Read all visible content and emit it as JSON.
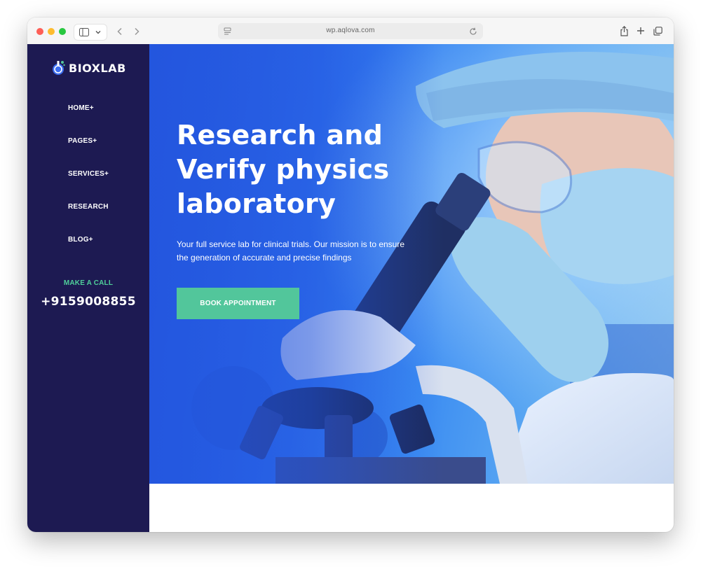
{
  "browser": {
    "url": "wp.aqlova.com"
  },
  "brand": {
    "name": "BIOXLAB",
    "accent": "#52c69b",
    "sidebar_bg": "#1d1a52",
    "hero_blue": "#2f72ee"
  },
  "nav": {
    "items": [
      {
        "label": "HOME+"
      },
      {
        "label": "PAGES+"
      },
      {
        "label": "SERVICES+"
      },
      {
        "label": "RESEARCH"
      },
      {
        "label": "BLOG+"
      }
    ]
  },
  "contact": {
    "label": "MAKE A CALL",
    "phone": "+9159008855"
  },
  "hero": {
    "headline_line1": "Research and",
    "headline_line2": "Verify physics",
    "headline_line3": "laboratory",
    "subtext_line1": "Your full service lab for clinical trials. Our mission is to ensure",
    "subtext_line2": "the generation of accurate and precise findings",
    "cta_label": "BOOK APPOINTMENT"
  }
}
